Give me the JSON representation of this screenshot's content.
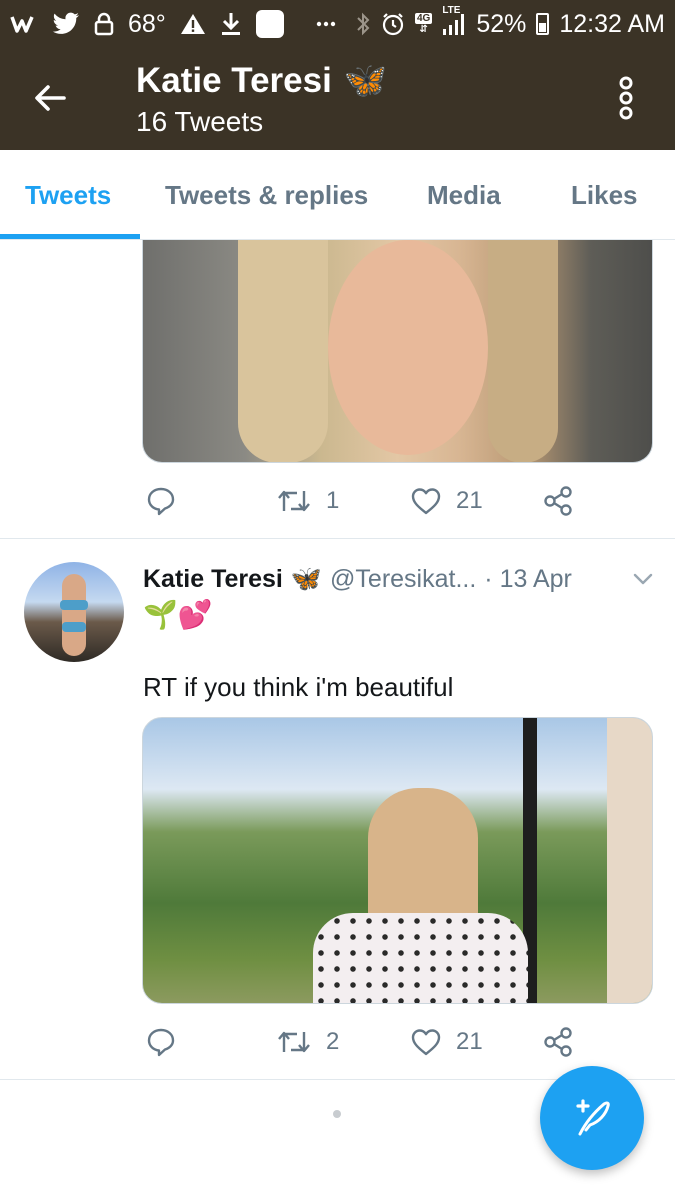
{
  "status_bar": {
    "temperature": "68°",
    "lte_label": "LTE",
    "net_label": "4G",
    "battery": "52%",
    "time": "12:32 AM"
  },
  "header": {
    "title": "Katie Teresi",
    "title_emoji": "🦋",
    "subtitle": "16 Tweets"
  },
  "tabs": [
    {
      "label": "Tweets",
      "active": true
    },
    {
      "label": "Tweets & replies",
      "active": false
    },
    {
      "label": "Media",
      "active": false
    },
    {
      "label": "Likes",
      "active": false
    }
  ],
  "tweets": [
    {
      "retweets": "1",
      "likes": "21"
    },
    {
      "name": "Katie Teresi",
      "name_emoji": "🦋",
      "handle": "@Teresikat...",
      "date": "· 13 Apr",
      "emojis": "🌱💕",
      "text": "RT if you think i'm beautiful",
      "retweets": "2",
      "likes": "21"
    }
  ],
  "colors": {
    "header_bg": "#3b3326",
    "accent": "#1da1f2",
    "muted": "#657786"
  }
}
